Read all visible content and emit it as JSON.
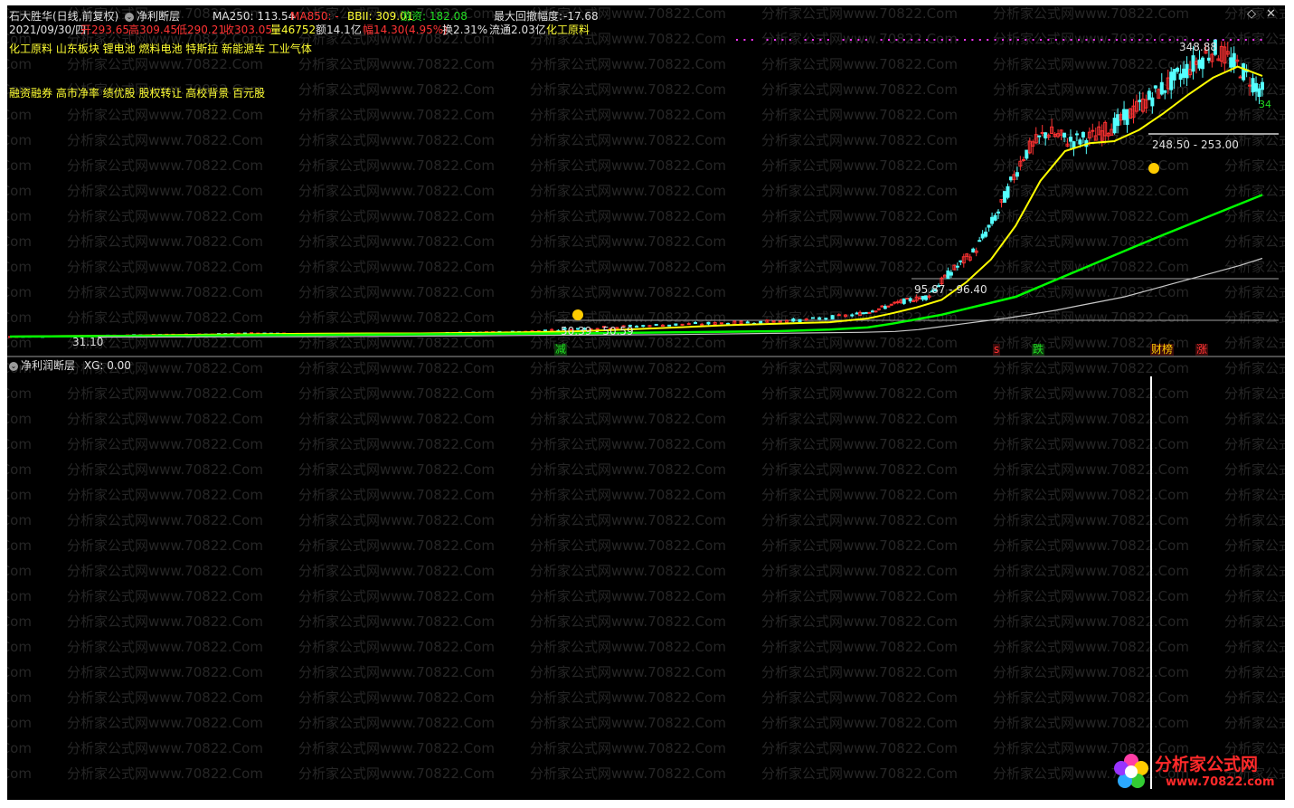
{
  "header": {
    "title": "石大胜华(日线,前复权)",
    "indicator_name": "净利断层",
    "ma250_label": "MA250: 113.54",
    "ma850_label": "MA850: -",
    "bbii_label": "BBII: 309.01",
    "youzi_label": "游资: 182.08",
    "max_drawdown_label": "最大回撤幅度:",
    "max_drawdown_value": "-17.68"
  },
  "quote": {
    "date": "2021/09/30/四",
    "open": "开293.65",
    "high": "高309.45",
    "low": "低290.21",
    "close": "收303.05",
    "volume": "量46752",
    "amount": "额14.1亿",
    "amplitude": "幅14.30(4.95%)",
    "turnover": "换2.31%",
    "float": "流通2.03亿",
    "sector": "化工原料"
  },
  "concepts_line1": "化工原料 山东板块 锂电池 燃料电池 特斯拉 新能源车 工业气体",
  "concepts_line2": "融资融券 高市净率 绩优股 股权转让 高校背景 百元股",
  "price_annotations": {
    "peak_price": "348.88",
    "zone_top": "248.50 - 253.00",
    "zone_mid": "95.87 - 96.40",
    "zone_low": "50.39 - 50.59",
    "min_price": "31.10",
    "end_label": "34"
  },
  "event_tags": [
    {
      "text": "减",
      "color": "#22dd22",
      "bg": "#0b3a0b"
    },
    {
      "text": "s",
      "color": "#ff3333",
      "bg": "#3a0b0b"
    },
    {
      "text": "跌",
      "color": "#22dd22",
      "bg": "#0b3a0b"
    },
    {
      "text": "财榜",
      "color": "#ffcc00",
      "bg": "#3a0b0b"
    },
    {
      "text": "涨",
      "color": "#ff3333",
      "bg": "#3a0b0b"
    }
  ],
  "lower_panel": {
    "name": "净利润断层",
    "xg_label": "XG: 0.00"
  },
  "watermark": "分析家公式网www.70822.Com",
  "logo": {
    "brand": "分析家公式网",
    "url": "www.70822.com"
  },
  "colors": {
    "background": "#000000",
    "up_candle": "#ff3232",
    "down_candle": "#54ffff",
    "ma_short": "#ffff00",
    "ma_mid": "#00ff00",
    "ma_long": "#c8c8c8",
    "zone_line": "#a0a0a0"
  },
  "chart_data": {
    "type": "line",
    "x_range": [
      0,
      100
    ],
    "price_range": [
      20,
      360
    ],
    "series": [
      {
        "values": [
          31.1,
          33,
          35,
          38,
          40,
          44,
          40,
          42,
          41,
          45,
          48,
          52,
          55,
          58,
          60,
          62,
          65,
          72,
          80,
          90,
          96,
          120,
          140,
          180,
          235,
          260,
          250,
          255,
          270,
          290,
          310,
          330,
          348.88,
          330,
          303
        ]
      },
      {
        "values": [
          31,
          33,
          34,
          36,
          38,
          40,
          41,
          42,
          42,
          44,
          46,
          49,
          52,
          55,
          58,
          60,
          62,
          67,
          74,
          82,
          92,
          110,
          132,
          165,
          210,
          240,
          248,
          250,
          262,
          280,
          300,
          318,
          330,
          320
        ]
      },
      {
        "values": [
          31,
          32,
          33,
          34,
          35,
          36,
          37,
          38,
          39,
          40,
          41,
          42,
          44,
          46,
          48,
          50,
          52,
          55,
          60,
          66,
          72,
          80,
          88,
          96,
          106,
          116,
          126,
          136,
          146,
          156,
          166,
          176,
          186,
          196
        ]
      },
      {
        "values": [
          28,
          28.5,
          29,
          29.5,
          30,
          31,
          32,
          33,
          34,
          35,
          36,
          37,
          38,
          40,
          42,
          44,
          46,
          49,
          52,
          56,
          60,
          64,
          68,
          73,
          78,
          84,
          90,
          96,
          102,
          108,
          114,
          120,
          126,
          133
        ]
      }
    ],
    "xg_values": [
      0,
      0,
      0,
      0,
      0,
      0,
      0,
      0,
      0,
      0,
      0,
      0,
      0,
      0,
      0,
      0,
      0,
      0,
      0,
      0,
      0,
      0,
      0,
      0,
      0,
      0,
      0,
      1,
      0,
      0,
      0,
      0,
      0,
      0
    ]
  }
}
